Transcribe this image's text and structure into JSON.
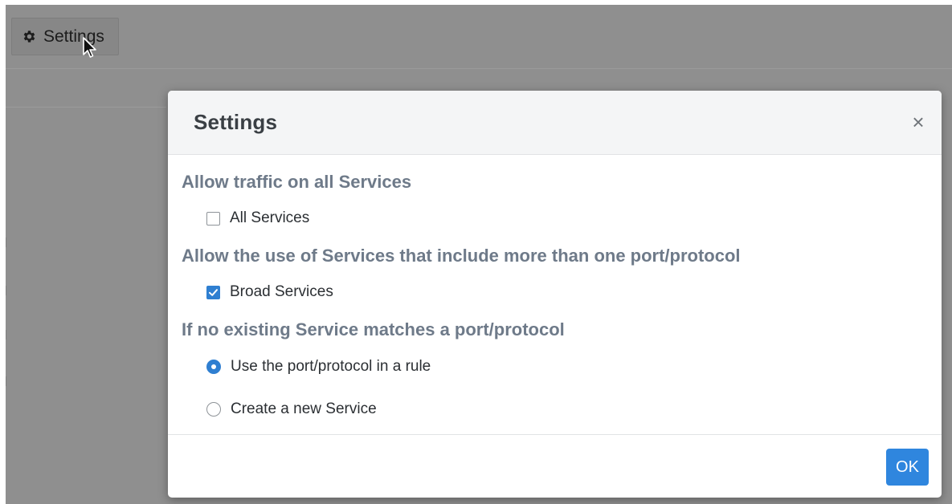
{
  "toolbar": {
    "settings_label": "Settings",
    "settings_icon": "gear-icon"
  },
  "cursor": {
    "icon": "mouse-pointer-icon"
  },
  "modal": {
    "title": "Settings",
    "close_label": "×",
    "sections": [
      {
        "heading": "Allow traffic on all Services",
        "options": [
          {
            "type": "checkbox",
            "label": "All Services",
            "checked": false
          }
        ]
      },
      {
        "heading": "Allow the use of Services that include more than one port/protocol",
        "options": [
          {
            "type": "checkbox",
            "label": "Broad Services",
            "checked": true
          }
        ]
      },
      {
        "heading": "If no existing Service matches a port/protocol",
        "options": [
          {
            "type": "radio",
            "label": "Use the port/protocol in a rule",
            "checked": true
          },
          {
            "type": "radio",
            "label": "Create a new Service",
            "checked": false
          }
        ]
      }
    ],
    "ok_label": "OK"
  },
  "colors": {
    "accent": "#2f7fd1",
    "ok_button": "#2f86de",
    "section_heading": "#6e7a89",
    "overlay": "#8f8f8f"
  }
}
